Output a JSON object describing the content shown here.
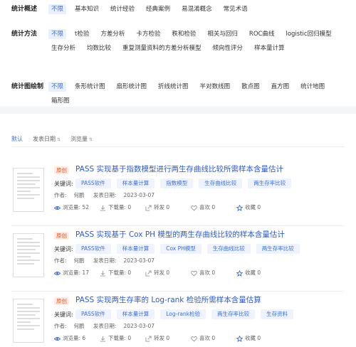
{
  "filters": {
    "overview": {
      "label": "统计概述",
      "options": [
        "不限",
        "基本知识",
        "统计经验",
        "经典案例",
        "易混淆概念",
        "常见术语"
      ]
    },
    "methods": {
      "label": "统计方法",
      "options": [
        "不限",
        "t检验",
        "方差分析",
        "卡方检验",
        "秩和检验",
        "相关与回归",
        "ROC曲线",
        "logistic回归模型",
        "生存分析",
        "均数比较",
        "重复测量资料的方差分析模型",
        "倾向性评分",
        "样本量计算"
      ]
    },
    "charts": {
      "label": "统计图绘制",
      "options": [
        "不限",
        "条形统计图",
        "扇形统计图",
        "折线统计图",
        "半对数线图",
        "散点图",
        "直方图",
        "统计地图",
        "箱形图"
      ]
    }
  },
  "sort": {
    "default": "默认",
    "date": "发表日期",
    "views": "浏览量"
  },
  "labels": {
    "badge": "原创",
    "keywords": "关键词:",
    "author": "作者:",
    "date": "发表日期:",
    "views": "浏览量:",
    "downloads": "下载量:",
    "shares": "转发",
    "likes": "喜欢",
    "favorites": "收藏"
  },
  "articles": [
    {
      "title": "PASS 实现基于指数模型进行两生存曲线比较所需样本含量估计",
      "keywords": [
        "PASS软件",
        "样本量计算",
        "指数模型",
        "生存曲线比较",
        "两生存率比较"
      ],
      "author": "何鹏",
      "date": "2023-03-07",
      "views": "52",
      "downloads": "0",
      "shares": "0",
      "likes": "0",
      "favorites": "0"
    },
    {
      "title": "PASS 实现基于 Cox PH 模型的两生存曲线比较的样本含量估计",
      "keywords": [
        "PASS软件",
        "样本量计算",
        "Cox PH模型",
        "生存曲线比较",
        "两生存率比较"
      ],
      "author": "何鹏",
      "date": "2023-03-07",
      "views": "17",
      "downloads": "0",
      "shares": "0",
      "likes": "0",
      "favorites": "0"
    },
    {
      "title": "PASS 实现两生存率的 Log-rank 检验所需样本含量估算",
      "keywords": [
        "PASS软件",
        "样本量计算",
        "Log-rank检验",
        "两生存率比较",
        "生存资料"
      ],
      "author": "何鹏",
      "date": "2023-03-07",
      "views": "6",
      "downloads": "0",
      "shares": "0",
      "likes": "0",
      "favorites": "0"
    }
  ]
}
